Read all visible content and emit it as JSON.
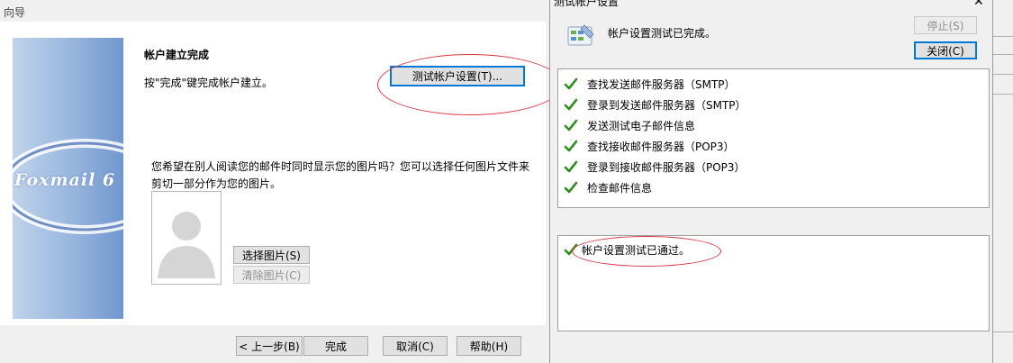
{
  "wizard": {
    "title": "向导",
    "brand_text": "Foxmail 6",
    "step_heading": "帐户建立完成",
    "finish_hint": "按\"完成\"键完成帐户建立。",
    "test_button": "测试帐户设置(T)...",
    "photo_prompt": "您希望在别人阅读您的邮件时同时显示您的图片吗？您可以选择任何图片文件来剪切一部分作为您的图片。",
    "select_picture_button": "选择图片(S)",
    "clear_picture_button": "清除图片(C)",
    "back_button": "< 上一步(B)",
    "finish_button": "完成",
    "cancel_button": "取消(C)",
    "help_button": "帮助(H)"
  },
  "dialog": {
    "title": "测试帐户设置",
    "close_glyph": "✕",
    "status": "帐户设置测试已完成。",
    "stop_button": "停止(S)",
    "close_button": "关闭(C)",
    "tasks": [
      {
        "label": "查找发送邮件服务器（SMTP）",
        "status": "done"
      },
      {
        "label": "登录到发送邮件服务器（SMTP）",
        "status": "done"
      },
      {
        "label": "发送测试电子邮件信息",
        "status": "done"
      },
      {
        "label": "查找接收邮件服务器（POP3）",
        "status": "done"
      },
      {
        "label": "登录到接收邮件服务器（POP3）",
        "status": "done"
      },
      {
        "label": "检查邮件信息",
        "status": "done"
      }
    ],
    "result": {
      "label": "帐户设置测试已通过。",
      "status": "done"
    }
  },
  "icons": {
    "check": "checkmark-icon",
    "dialog": "test-settings-icon",
    "avatar": "avatar-placeholder-icon"
  },
  "colors": {
    "check_green": "#2e8b1e",
    "annotation_red": "#d9363e",
    "focus_blue": "#0078d7",
    "banner_blue": "#7097cf"
  }
}
